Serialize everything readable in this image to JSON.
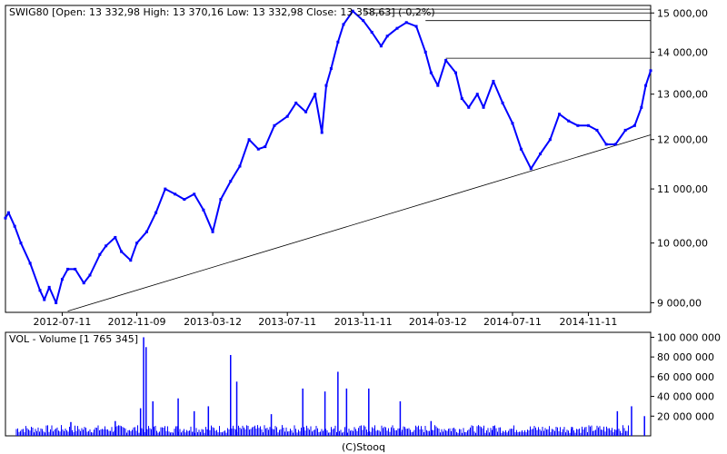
{
  "chart_data": [
    {
      "type": "line",
      "title": "SWIG80 [Open: 13 332,98  High: 13 370,16  Low: 13 332,98  Close: 13 358,63] (-0,2%)",
      "ylim": [
        8850,
        15200
      ],
      "y_scale": "log",
      "y_ticks": [
        9000,
        10000,
        11000,
        12000,
        13000,
        14000,
        15000
      ],
      "y_tick_labels": [
        "9 000,00",
        "10 000,00",
        "11 000,00",
        "12 000,00",
        "13 000,00",
        "14 000,00",
        "15 000,00"
      ],
      "x_range": [
        "2012-04-10",
        "2015-02-20"
      ],
      "x_ticks": [
        "2012-07-11",
        "2012-11-09",
        "2013-03-12",
        "2013-07-11",
        "2013-11-11",
        "2014-03-12",
        "2014-07-11",
        "2014-11-11"
      ],
      "x_tick_labels": [
        "2012-07-11",
        "2012-11-09",
        "2013-03-12",
        "2013-07-11",
        "2013-11-11",
        "2014-03-12",
        "2014-07-11",
        "2014-11-11"
      ],
      "grid": false,
      "series": [
        {
          "name": "SWIG80",
          "color": "#0000ff",
          "x": [
            "2012-04-10",
            "2012-04-15",
            "2012-04-25",
            "2012-05-05",
            "2012-05-20",
            "2012-06-05",
            "2012-06-12",
            "2012-06-20",
            "2012-07-01",
            "2012-07-11",
            "2012-07-20",
            "2012-08-01",
            "2012-08-15",
            "2012-08-25",
            "2012-09-10",
            "2012-09-20",
            "2012-10-05",
            "2012-10-15",
            "2012-10-30",
            "2012-11-09",
            "2012-11-25",
            "2012-12-10",
            "2012-12-25",
            "2013-01-10",
            "2013-01-25",
            "2013-02-10",
            "2013-02-25",
            "2013-03-12",
            "2013-03-25",
            "2013-04-10",
            "2013-04-25",
            "2013-05-10",
            "2013-05-25",
            "2013-06-05",
            "2013-06-20",
            "2013-07-11",
            "2013-07-25",
            "2013-08-10",
            "2013-08-25",
            "2013-09-05",
            "2013-09-12",
            "2013-09-20",
            "2013-10-01",
            "2013-10-10",
            "2013-10-25",
            "2013-11-11",
            "2013-11-25",
            "2013-12-10",
            "2013-12-20",
            "2014-01-05",
            "2014-01-20",
            "2014-02-05",
            "2014-02-20",
            "2014-03-01",
            "2014-03-12",
            "2014-03-25",
            "2014-04-10",
            "2014-04-20",
            "2014-05-01",
            "2014-05-15",
            "2014-05-25",
            "2014-06-10",
            "2014-06-25",
            "2014-07-11",
            "2014-07-25",
            "2014-08-10",
            "2014-08-25",
            "2014-09-10",
            "2014-09-25",
            "2014-10-10",
            "2014-10-25",
            "2014-11-11",
            "2014-11-25",
            "2014-12-10",
            "2014-12-25",
            "2015-01-10",
            "2015-01-25",
            "2015-02-05",
            "2015-02-12",
            "2015-02-20"
          ],
          "values": [
            10450,
            10550,
            10300,
            10000,
            9650,
            9200,
            9050,
            9250,
            9000,
            9380,
            9550,
            9550,
            9320,
            9450,
            9800,
            9950,
            10100,
            9850,
            9700,
            10000,
            10200,
            10550,
            11000,
            10900,
            10800,
            10900,
            10600,
            10200,
            10800,
            11150,
            11450,
            12000,
            11800,
            11850,
            12300,
            12500,
            12800,
            12600,
            13000,
            12150,
            13200,
            13600,
            14250,
            14700,
            15050,
            14800,
            14500,
            14150,
            14400,
            14600,
            14750,
            14650,
            14000,
            13500,
            13200,
            13800,
            13500,
            12900,
            12700,
            13000,
            12700,
            13300,
            12800,
            12350,
            11800,
            11400,
            11700,
            12000,
            12550,
            12400,
            12300,
            12300,
            12200,
            11900,
            11900,
            12200,
            12300,
            12700,
            13200,
            13550
          ]
        }
      ],
      "annotations": [
        {
          "type": "trendline",
          "from": [
            "2012-07-20",
            8870
          ],
          "to": [
            "2015-02-20",
            12100
          ]
        },
        {
          "type": "hline",
          "from": "2013-11-11",
          "value": 15100
        },
        {
          "type": "hline",
          "from": "2013-11-11",
          "value": 15000
        },
        {
          "type": "hline",
          "from": "2014-02-20",
          "value": 14800
        },
        {
          "type": "hline",
          "from": "2014-03-25",
          "value": 13850
        }
      ]
    },
    {
      "type": "bar",
      "title": "VOL - Volume [1 765 345]",
      "ylim": [
        0,
        105000000
      ],
      "y_ticks": [
        20000000,
        40000000,
        60000000,
        80000000,
        100000000
      ],
      "y_tick_labels": [
        "20 000 000",
        "40 000 000",
        "60 000 000",
        "80 000 000",
        "100 000 000"
      ],
      "series": [
        {
          "name": "VOL",
          "color": "#0000ff",
          "base": 5000000,
          "spikes": [
            {
              "x": "2012-07-25",
              "value": 14000000
            },
            {
              "x": "2012-10-05",
              "value": 15000000
            },
            {
              "x": "2012-11-15",
              "value": 28000000
            },
            {
              "x": "2012-11-20",
              "value": 100000000
            },
            {
              "x": "2012-11-24",
              "value": 90000000
            },
            {
              "x": "2012-12-05",
              "value": 35000000
            },
            {
              "x": "2013-01-15",
              "value": 38000000
            },
            {
              "x": "2013-02-10",
              "value": 25000000
            },
            {
              "x": "2013-03-05",
              "value": 30000000
            },
            {
              "x": "2013-04-10",
              "value": 82000000
            },
            {
              "x": "2013-04-20",
              "value": 55000000
            },
            {
              "x": "2013-06-15",
              "value": 22000000
            },
            {
              "x": "2013-08-05",
              "value": 48000000
            },
            {
              "x": "2013-09-10",
              "value": 45000000
            },
            {
              "x": "2013-10-01",
              "value": 65000000
            },
            {
              "x": "2013-10-15",
              "value": 48000000
            },
            {
              "x": "2013-11-20",
              "value": 48000000
            },
            {
              "x": "2014-01-10",
              "value": 35000000
            },
            {
              "x": "2014-03-01",
              "value": 15000000
            },
            {
              "x": "2014-06-10",
              "value": 10000000
            },
            {
              "x": "2014-10-15",
              "value": 9000000
            },
            {
              "x": "2014-12-28",
              "value": 25000000
            },
            {
              "x": "2015-01-20",
              "value": 30000000
            },
            {
              "x": "2015-02-10",
              "value": 20000000
            }
          ]
        }
      ]
    }
  ],
  "footer": {
    "credit": "(C)Stooq"
  },
  "colors": {
    "series": "#0000ff",
    "frame": "#000000",
    "overlay": "#000000",
    "background": "#ffffff"
  }
}
